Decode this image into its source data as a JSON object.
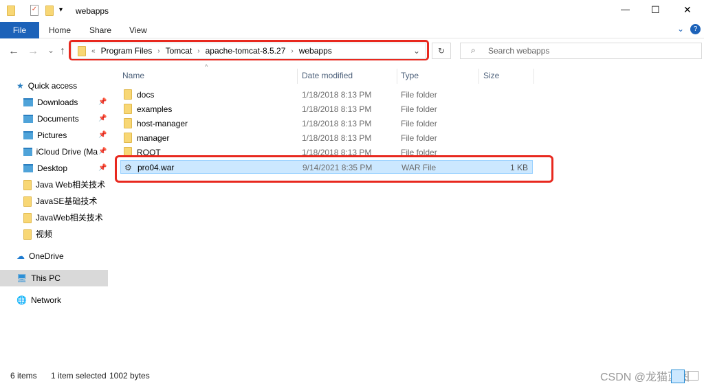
{
  "window": {
    "title": "webapps",
    "minimize": "—",
    "maximize": "☐",
    "close": "✕"
  },
  "ribbon": {
    "tabs": [
      "File",
      "Home",
      "Share",
      "View"
    ]
  },
  "nav": {
    "back": "←",
    "forward": "→",
    "recent": "⌄",
    "up": "↑",
    "refresh": "↻",
    "expand": "⌄"
  },
  "address": {
    "overflow": "«",
    "crumbs": [
      "Program Files",
      "Tomcat",
      "apache-tomcat-8.5.27",
      "webapps"
    ]
  },
  "search": {
    "placeholder": "Search webapps"
  },
  "sidebar": {
    "quick_access": "Quick access",
    "items": [
      {
        "label": "Downloads",
        "pinned": true
      },
      {
        "label": "Documents",
        "pinned": true
      },
      {
        "label": "Pictures",
        "pinned": true
      },
      {
        "label": "iCloud Drive (Ma",
        "pinned": true
      },
      {
        "label": "Desktop",
        "pinned": true
      },
      {
        "label": "Java Web相关技术",
        "pinned": false
      },
      {
        "label": "JavaSE基础技术",
        "pinned": false
      },
      {
        "label": "JavaWeb相关技术",
        "pinned": false
      },
      {
        "label": "视频",
        "pinned": false
      }
    ],
    "onedrive": "OneDrive",
    "this_pc": "This PC",
    "network": "Network"
  },
  "columns": {
    "name": "Name",
    "date": "Date modified",
    "type": "Type",
    "size": "Size"
  },
  "files": [
    {
      "name": "docs",
      "date": "1/18/2018 8:13 PM",
      "type": "File folder",
      "size": ""
    },
    {
      "name": "examples",
      "date": "1/18/2018 8:13 PM",
      "type": "File folder",
      "size": ""
    },
    {
      "name": "host-manager",
      "date": "1/18/2018 8:13 PM",
      "type": "File folder",
      "size": ""
    },
    {
      "name": "manager",
      "date": "1/18/2018 8:13 PM",
      "type": "File folder",
      "size": ""
    },
    {
      "name": "ROOT",
      "date": "1/18/2018 8:13 PM",
      "type": "File folder",
      "size": ""
    },
    {
      "name": "pro04.war",
      "date": "9/14/2021 8:35 PM",
      "type": "WAR File",
      "size": "1 KB",
      "selected": true
    }
  ],
  "status": {
    "count": "6 items",
    "selected": "1 item selected",
    "size": "1002 bytes"
  },
  "watermark": "CSDN @龙猫蓝图",
  "colors": {
    "accent": "#1c62b9",
    "highlight": "#e8281e",
    "selection": "#cce8ff"
  }
}
